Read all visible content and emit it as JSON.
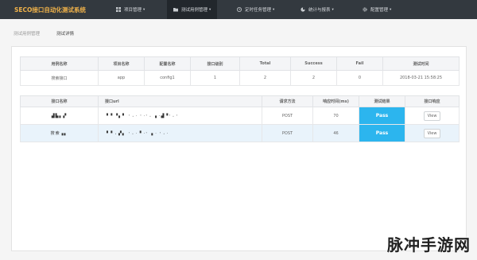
{
  "nav": {
    "brand": "SECO接口自动化测试系统",
    "items": [
      {
        "label": "项目管理",
        "icon": "grid-icon"
      },
      {
        "label": "测试用例管理",
        "icon": "folder-icon"
      },
      {
        "label": "定时任务管理",
        "icon": "clock-icon"
      },
      {
        "label": "统计与报表",
        "icon": "chart-icon"
      },
      {
        "label": "配置管理",
        "icon": "gear-icon"
      }
    ],
    "caret": "▾"
  },
  "breadcrumb": {
    "parent": "测试用例管理",
    "current": "测试详情"
  },
  "summary": {
    "headers": [
      "用例名称",
      "项目名称",
      "配置名称",
      "接口级别",
      "Total",
      "Success",
      "Fail",
      "测试时间"
    ],
    "row": [
      "搜索接口",
      "app",
      "config1",
      "1",
      "2",
      "2",
      "0",
      "2018-03-21 15:58:25"
    ]
  },
  "detail": {
    "headers": [
      "接口名称",
      "接口url",
      "请求方法",
      "响应时间(ms)",
      "测试结果",
      "接口响应"
    ],
    "rows": [
      {
        "name": "▟▙▖▞",
        "url": "▝ ▘▝▖▘   ⠂⠄·  ⠂·⠂⠄ ▖·▟▝⠂⠄⠂",
        "method": "POST",
        "time": "70",
        "result": "Pass",
        "action": "View"
      },
      {
        "name": "搜索▗▖",
        "url": "▝ ▘⠄▞▖  ⠂⠄·  ▘·⠂ ▖· ⠂⠄·",
        "method": "POST",
        "time": "46",
        "result": "Pass",
        "action": "View"
      }
    ]
  },
  "watermark": "脉冲手游网",
  "colors": {
    "nav_bg": "#33393f",
    "brand": "#f0b24a",
    "pass": "#2cb5ee",
    "row_highlight": "#e9f3fb"
  }
}
